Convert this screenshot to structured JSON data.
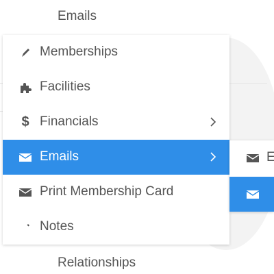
{
  "background": {
    "top_text": "Emails",
    "bottom_text": "Relationships"
  },
  "menu": {
    "items": [
      {
        "label": "Memberships",
        "icon": "pencil-icon",
        "has_submenu": false
      },
      {
        "label": "Facilities",
        "icon": "puzzle-icon",
        "has_submenu": false
      },
      {
        "label": "Financials",
        "icon": "dollar-icon",
        "has_submenu": true
      },
      {
        "label": "Emails",
        "icon": "envelope-icon",
        "has_submenu": true,
        "active": true
      },
      {
        "label": "Print Membership Card",
        "icon": "envelope-icon",
        "has_submenu": false
      },
      {
        "label": "Notes",
        "icon": "pencil-icon",
        "has_submenu": false
      }
    ]
  },
  "submenu": {
    "items": [
      {
        "label": "E",
        "icon": "envelope-icon"
      },
      {
        "label": "",
        "icon": "envelope-icon",
        "active": true
      }
    ]
  },
  "colors": {
    "accent": "#2f8ee8",
    "text": "#555555"
  }
}
